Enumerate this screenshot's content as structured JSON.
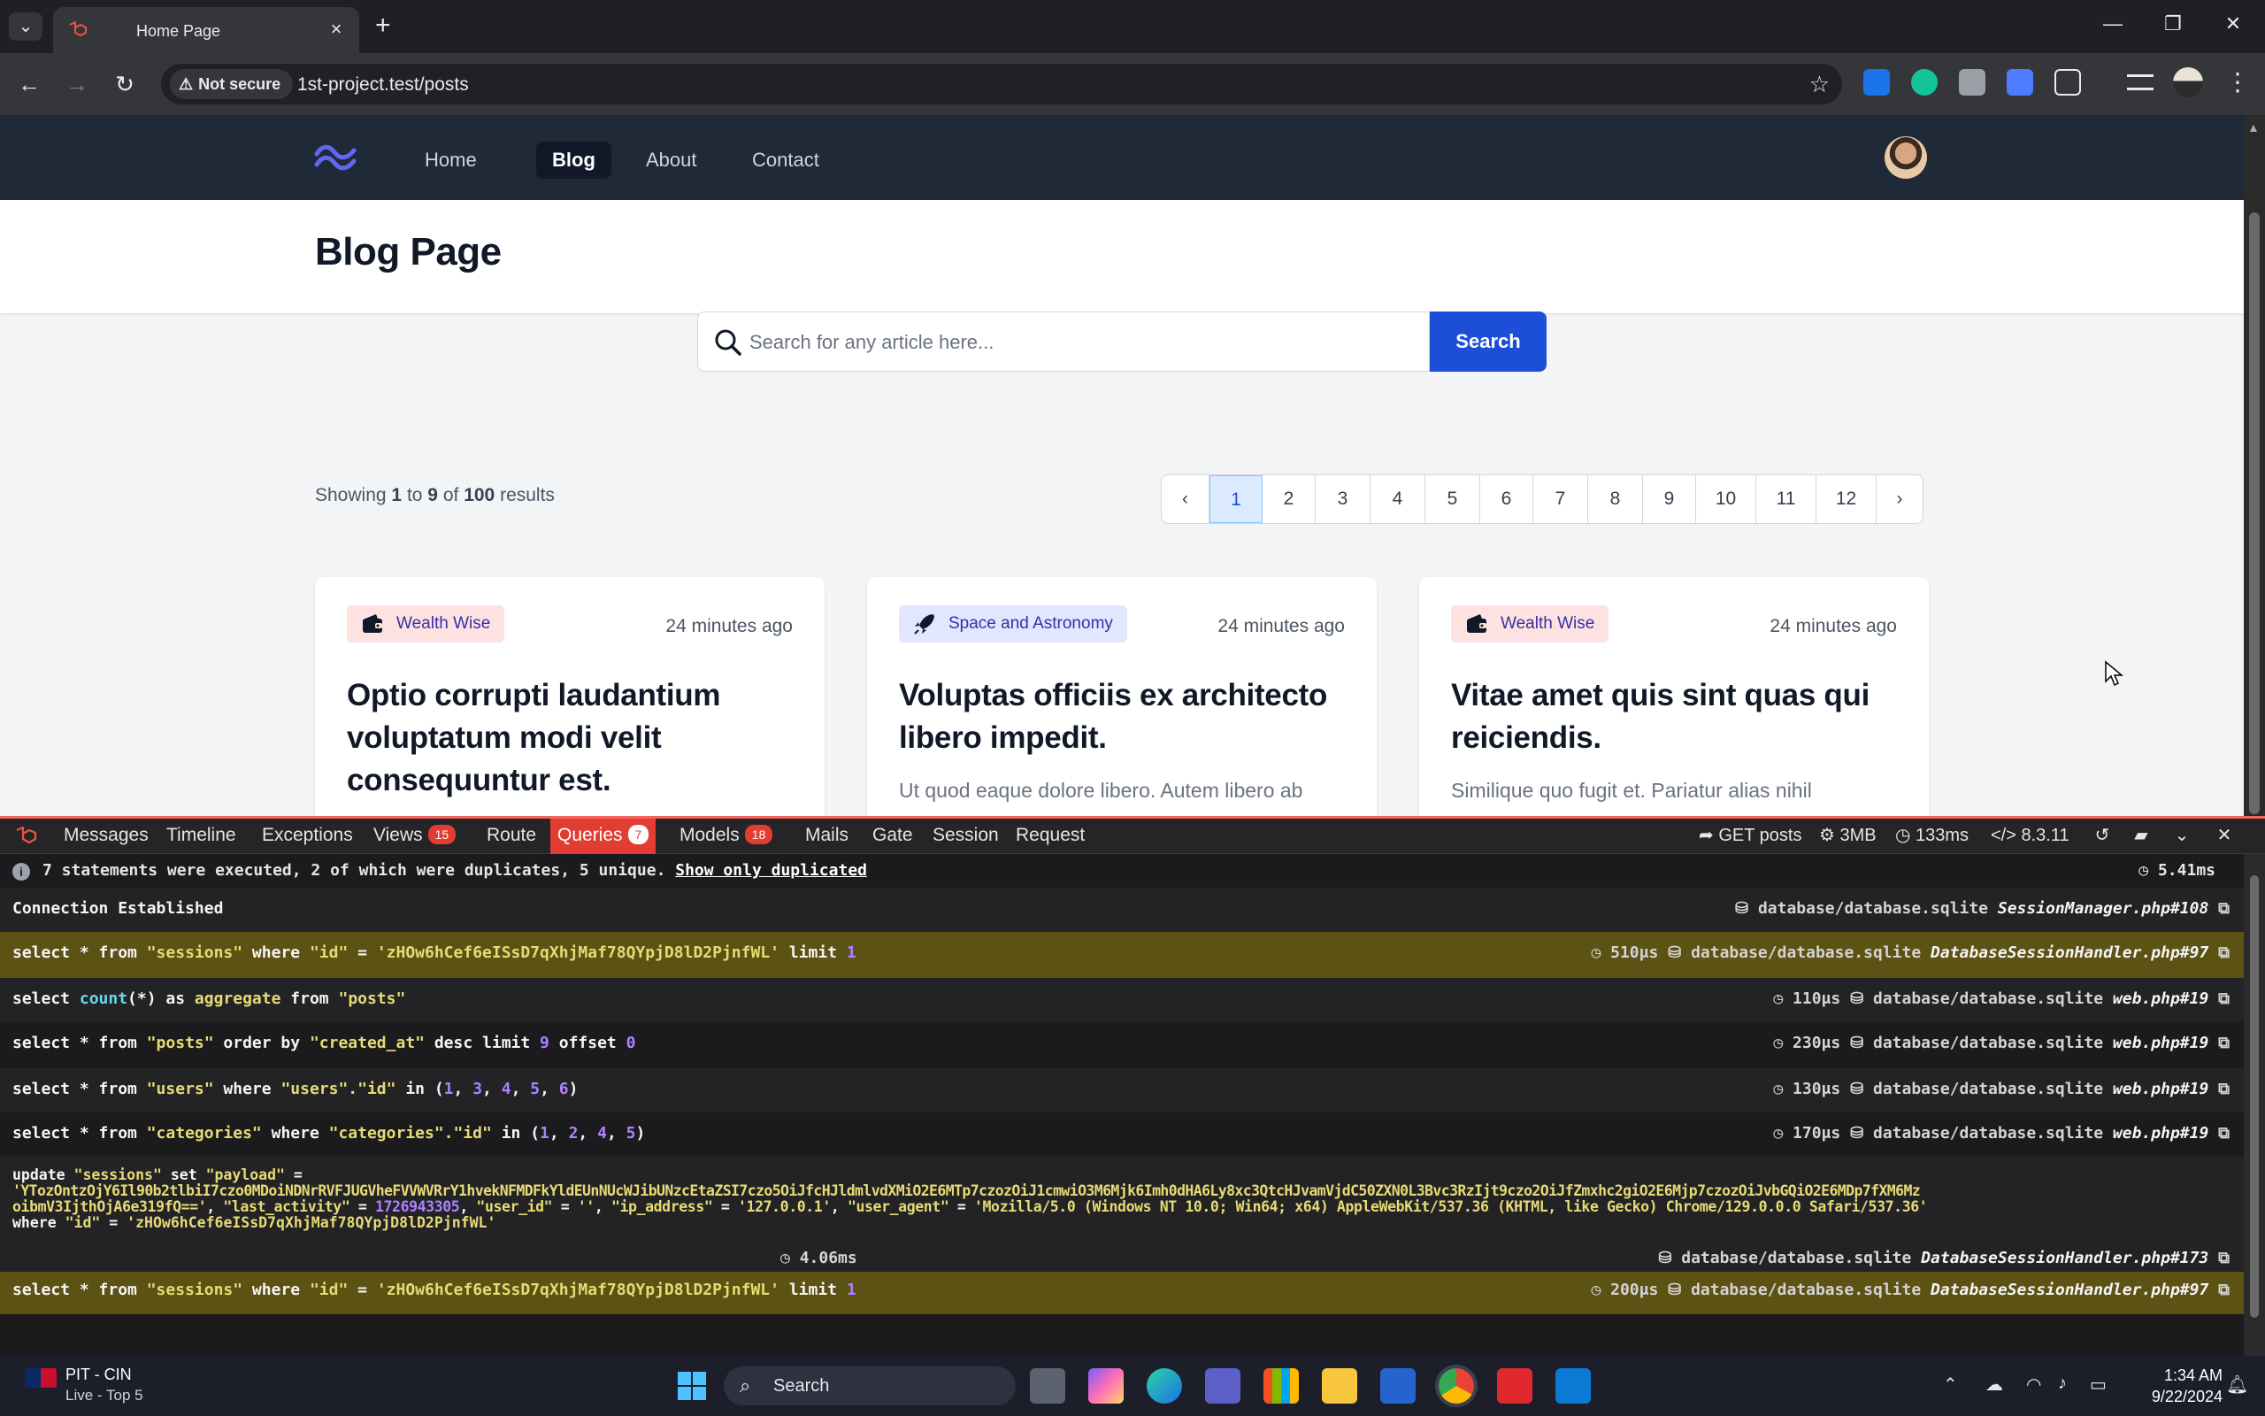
{
  "browser": {
    "tab_title": "Home Page",
    "new_tab_symbol": "+",
    "tab_close_symbol": "×",
    "security_label": "Not secure",
    "url": "1st-project.test/posts",
    "window_controls": {
      "minimize": "—",
      "restore": "❐",
      "close": "✕"
    },
    "nav_icons": {
      "back": "←",
      "forward": "→",
      "reload": "↻",
      "star": "☆",
      "menu": "⋮",
      "tab_list": "⌄"
    }
  },
  "site": {
    "nav_links": [
      "Home",
      "Blog",
      "About",
      "Contact"
    ],
    "active_link": "Blog",
    "page_title": "Blog Page",
    "search": {
      "placeholder": "Search for any article here...",
      "button": "Search"
    },
    "results": {
      "prefix": "Showing",
      "from": "1",
      "to_word": "to",
      "to": "9",
      "of_word": "of",
      "total": "100",
      "suffix": "results"
    },
    "pagination": {
      "prev": "‹",
      "next": "›",
      "pages": [
        "1",
        "2",
        "3",
        "4",
        "5",
        "6",
        "7",
        "8",
        "9",
        "10",
        "11",
        "12"
      ],
      "current": "1"
    },
    "posts": [
      {
        "category": "Wealth Wise",
        "category_color": "#fee2e2",
        "category_icon": "wallet-icon",
        "time": "24 minutes ago",
        "title": "Optio corrupti laudantium voluptatum modi velit consequuntur est.",
        "excerpt": ""
      },
      {
        "category": "Space and Astronomy",
        "category_color": "#e0e7ff",
        "category_icon": "rocket-icon",
        "time": "24 minutes ago",
        "title": "Voluptas officiis ex architecto libero impedit.",
        "excerpt": "Ut quod eaque dolore libero. Autem libero ab"
      },
      {
        "category": "Wealth Wise",
        "category_color": "#fee2e2",
        "category_icon": "wallet-icon",
        "time": "24 minutes ago",
        "title": "Vitae amet quis sint quas qui reiciendis.",
        "excerpt": "Similique quo fugit et. Pariatur alias nihil"
      }
    ]
  },
  "debugbar": {
    "accent": "#e23d33",
    "tabs": [
      {
        "label": "Messages",
        "count": ""
      },
      {
        "label": "Timeline",
        "count": ""
      },
      {
        "label": "Exceptions",
        "count": ""
      },
      {
        "label": "Views",
        "count": "15"
      },
      {
        "label": "Route",
        "count": ""
      },
      {
        "label": "Queries",
        "count": "7"
      },
      {
        "label": "Models",
        "count": "18"
      },
      {
        "label": "Mails",
        "count": ""
      },
      {
        "label": "Gate",
        "count": ""
      },
      {
        "label": "Session",
        "count": ""
      },
      {
        "label": "Request",
        "count": ""
      }
    ],
    "active_tab": "Queries",
    "meta": {
      "route": "GET posts",
      "memory": "3MB",
      "time": "133ms",
      "php": "8.3.11"
    },
    "summary": {
      "text": "7 statements were executed, 2 of which were duplicates, 5 unique.",
      "link": "Show only duplicated",
      "total_time": "5.41ms"
    },
    "connection": {
      "label": "Connection Established",
      "db": "database/database.sqlite",
      "source": "SessionManager.php#108"
    },
    "queries": [
      {
        "duplicate": true,
        "time": "510μs",
        "db": "database/database.sqlite",
        "source": "DatabaseSessionHandler.php#97"
      },
      {
        "duplicate": false,
        "time": "110μs",
        "db": "database/database.sqlite",
        "source": "web.php#19"
      },
      {
        "duplicate": false,
        "time": "230μs",
        "db": "database/database.sqlite",
        "source": "web.php#19"
      },
      {
        "duplicate": false,
        "time": "130μs",
        "db": "database/database.sqlite",
        "source": "web.php#19"
      },
      {
        "duplicate": false,
        "time": "170μs",
        "db": "database/database.sqlite",
        "source": "web.php#19"
      },
      {
        "duplicate": false,
        "time": "4.06ms",
        "db": "database/database.sqlite",
        "source": "DatabaseSessionHandler.php#173"
      },
      {
        "duplicate": true,
        "time": "200μs",
        "db": "database/database.sqlite",
        "source": "DatabaseSessionHandler.php#97"
      }
    ],
    "sql": {
      "q1": {
        "a": "select * from ",
        "b": "\"sessions\"",
        "c": " where ",
        "d": "\"id\"",
        "e": " = ",
        "f": "'zHOw6hCef6eISsD7qXhjMaf78QYpjD8lD2PjnfWL'",
        "g": " limit ",
        "h": "1"
      },
      "q2": {
        "a": "select ",
        "b": "count",
        "c": "(*) as ",
        "d": "aggregate",
        "e": " from ",
        "f": "\"posts\""
      },
      "q3": {
        "a": "select * from ",
        "b": "\"posts\"",
        "c": " order by ",
        "d": "\"created_at\"",
        "e": " desc limit ",
        "f": "9",
        "g": " offset ",
        "h": "0"
      },
      "q4": {
        "a": "select * from ",
        "b": "\"users\"",
        "c": " where ",
        "d": "\"users\".\"id\"",
        "e": " in (",
        "f": "1",
        "g": ", ",
        "h": "3",
        "i": ", ",
        "j": "4",
        "k": ", ",
        "l": "5",
        "m": ", ",
        "n": "6",
        "o": ")"
      },
      "q5": {
        "a": "select * from ",
        "b": "\"categories\"",
        "c": " where ",
        "d": "\"categories\".\"id\"",
        "e": " in (",
        "f": "1",
        "g": ", ",
        "h": "2",
        "i": ", ",
        "j": "4",
        "k": ", ",
        "l": "5",
        "m": ")"
      },
      "q6": {
        "l1a": "update ",
        "l1b": "\"sessions\"",
        "l1c": " set ",
        "l1d": "\"payload\"",
        "l1e": " =",
        "l2": "'YTozOntzOjY6Il90b2tlbiI7czo0MDoiNDNrRVFJUGVheFVVWVRrY1hvekNFMDFkYldEUnNUcWJibUNzcEtaZSI7czo5OiJfcHJldmlvdXMiO2E6MTp7czozOiJ1cmwiO3M6Mjk6Imh0dHA6Ly8xc3QtcHJvamVjdC50ZXN0L3Bvc3RzIjt9czo2OiJfZmxhc2giO2E6Mjp7czozOiJvbGQiO2E6MDp7fXM6Mz",
        "l3a": "oibmV3IjthOjA6e319fQ=='",
        "l3b": ", ",
        "l3c": "\"last_activity\"",
        "l3d": " = ",
        "l3e": "1726943305",
        "l3f": ", ",
        "l3g": "\"user_id\"",
        "l3h": " = ",
        "l3i": "''",
        "l3j": ", ",
        "l3k": "\"ip_address\"",
        "l3l": " = ",
        "l3m": "'127.0.0.1'",
        "l3n": ", ",
        "l3o": "\"user_agent\"",
        "l3p": " = ",
        "l3q": "'Mozilla/5.0 (Windows NT 10.0; Win64; x64) AppleWebKit/537.36 (KHTML, like Gecko) Chrome/129.0.0.0 Safari/537.36'",
        "l4a": "where ",
        "l4b": "\"id\"",
        "l4c": " = ",
        "l4d": "'zHOw6hCef6eISsD7qXhjMaf78QYpjD8lD2PjnfWL'"
      }
    }
  },
  "taskbar": {
    "score_title": "PIT - CIN",
    "score_sub": "Live - Top 5",
    "search_label": "Search",
    "time": "1:34 AM",
    "date": "9/22/2024"
  }
}
